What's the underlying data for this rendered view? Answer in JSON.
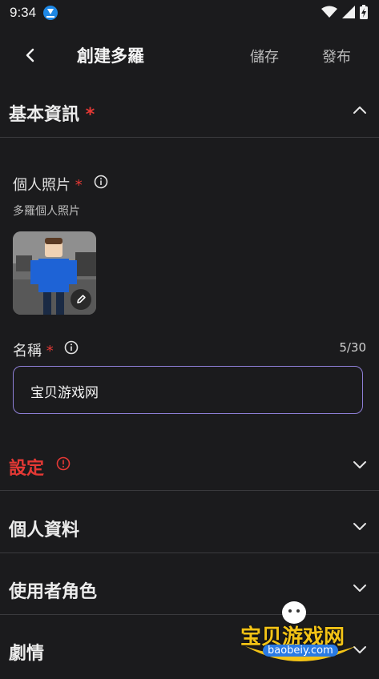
{
  "status_bar": {
    "time": "9:34",
    "download_icon": "download-icon",
    "wifi_icon": "wifi-icon",
    "signal_icon": "signal-icon",
    "battery_icon": "battery-charging-icon"
  },
  "appbar": {
    "title": "創建多羅",
    "save_label": "儲存",
    "publish_label": "發布"
  },
  "basic_info": {
    "header": "基本資訊",
    "required_mark": "*",
    "photo": {
      "label": "個人照片",
      "required_mark": "*",
      "sublabel": "多羅個人照片"
    },
    "name": {
      "label": "名稱",
      "required_mark": "*",
      "value": "宝贝游戏网",
      "counter": "5/30"
    }
  },
  "sections": [
    {
      "label": "設定",
      "error": true
    },
    {
      "label": "個人資料"
    },
    {
      "label": "使用者角色"
    },
    {
      "label": "劇情"
    }
  ],
  "watermark": {
    "text": "宝贝游戏网",
    "url": "baobeiy.com"
  },
  "colors": {
    "accent_input_border": "#8e7fd6",
    "required_red": "#e53935",
    "background": "#1b1b1d"
  }
}
